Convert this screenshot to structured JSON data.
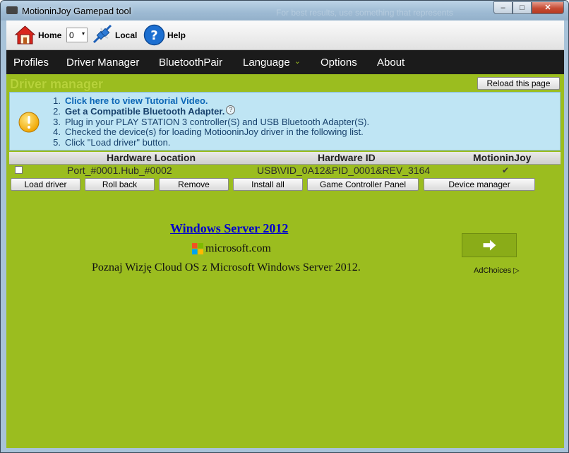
{
  "window": {
    "title": "MotioninJoy Gamepad tool",
    "ghost_text": "For best results, use something that represents",
    "minimize_symbol": "–",
    "maximize_symbol": "□",
    "close_symbol": "✕"
  },
  "toolbar": {
    "home_label": "Home",
    "controller_index": "0",
    "combo_arrow": "▾",
    "local_label": "Local",
    "help_label": "Help"
  },
  "menu": {
    "items": [
      "Profiles",
      "Driver Manager",
      "BluetoothPair",
      "Language",
      "Options",
      "About"
    ],
    "language_arrow": "⌄"
  },
  "page": {
    "heading": "Driver manager",
    "reload_label": "Reload this page"
  },
  "instructions": [
    {
      "num": "1.",
      "text": "Click here to view Tutorial Video."
    },
    {
      "num": "2.",
      "text": "Get a Compatible Bluetooth Adapter."
    },
    {
      "num": "3.",
      "text": "Plug in your PLAY STATION 3 controller(S) and USB Bluetooth Adapter(S)."
    },
    {
      "num": "4.",
      "text": "Checked the device(s) for loading MotiooninJoy driver in the following list."
    },
    {
      "num": "5.",
      "text": "Click \"Load driver\" button."
    }
  ],
  "help_symbol": "?",
  "device_table": {
    "columns": [
      "Hardware Location",
      "Hardware ID",
      "MotioninJoy"
    ],
    "rows": [
      {
        "location": "Port_#0001.Hub_#0002",
        "hardware_id": "USB\\VID_0A12&PID_0001&REV_3164",
        "loaded": "✔"
      }
    ]
  },
  "actions": {
    "load_driver": "Load driver",
    "roll_back": "Roll back",
    "remove": "Remove",
    "install_all": "Install all",
    "game_controller_panel": "Game Controller Panel",
    "device_manager": "Device manager"
  },
  "ad": {
    "title": "Windows Server 2012",
    "domain": "microsoft.com",
    "text": "Poznaj Wizję Cloud OS z Microsoft Windows Server 2012.",
    "choices_label": "AdChoices",
    "choices_symbol": "▷"
  },
  "colors": {
    "background_green": "#9bbd1f",
    "menubar": "#1b1b1b",
    "info_box": "#bfe5f4",
    "link_blue": "#0b66b6"
  }
}
